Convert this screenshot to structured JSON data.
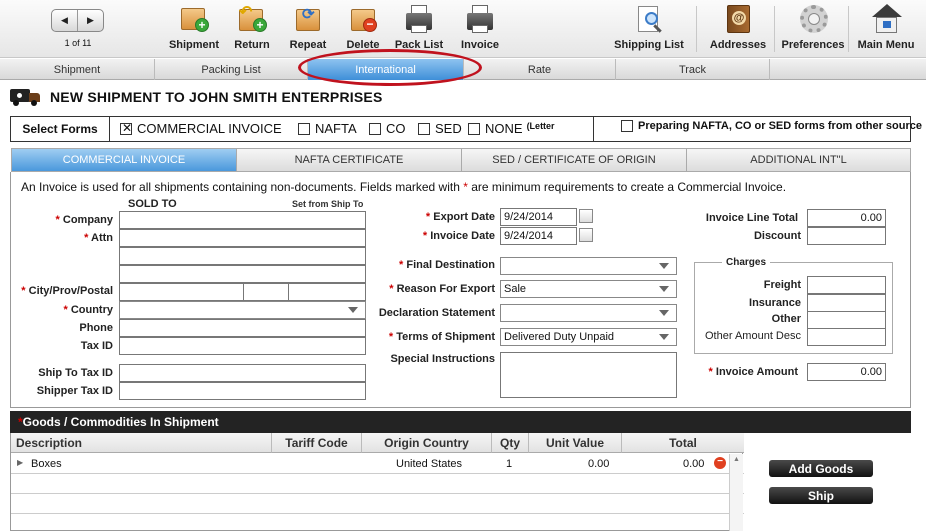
{
  "nav": {
    "prev_glyph": "◀",
    "next_glyph": "▶",
    "pager": "1 of 11"
  },
  "toolbar": {
    "shipment": "Shipment",
    "return": "Return",
    "repeat": "Repeat",
    "delete": "Delete",
    "packing_list": "Pack List",
    "invoice": "Invoice",
    "shipping_list": "Shipping List",
    "addresses": "Addresses",
    "preferences": "Preferences",
    "main_menu": "Main Menu"
  },
  "tabs": {
    "shipment": "Shipment",
    "packing_list": "Packing List",
    "international": "International",
    "rate": "Rate",
    "track": "Track"
  },
  "title": "NEW SHIPMENT TO JOHN SMITH ENTERPRISES",
  "forms": {
    "select_label": "Select Forms",
    "commercial_invoice": "COMMERCIAL INVOICE",
    "nafta": "NAFTA",
    "co": "CO",
    "sed": "SED",
    "none": "NONE",
    "none_note": "(Letter",
    "preparing": "Preparing NAFTA, CO or SED forms from other source",
    "checked_mark": "✕"
  },
  "subtabs": {
    "commercial_invoice": "COMMERCIAL INVOICE",
    "nafta_certificate": "NAFTA CERTIFICATE",
    "sed_certificate": "SED / CERTIFICATE OF ORIGIN",
    "additional": "ADDITIONAL INT\"L"
  },
  "intro": {
    "text": "An Invoice is used for all shipments containing non-documents. Fields marked with",
    "req_mark": "*",
    "text2": "are minimum requirements to create a Commercial Invoice."
  },
  "sold_to": {
    "heading": "SOLD TO",
    "set_from": "Set from Ship To",
    "req": "*",
    "company": "Company",
    "attn": "Attn",
    "city": "City/Prov/Postal",
    "country": "Country",
    "phone": "Phone",
    "tax_id": "Tax ID",
    "ship_to_tax_id": "Ship To Tax ID",
    "shipper_tax_id": "Shipper Tax ID"
  },
  "middle": {
    "export_date_label": "Export Date",
    "export_date": "9/24/2014",
    "invoice_date_label": "Invoice Date",
    "invoice_date": "9/24/2014",
    "final_destination": "Final Destination",
    "reason_label": "Reason For Export",
    "reason_value": "Sale",
    "declaration": "Declaration Statement",
    "terms_label": "Terms of Shipment",
    "terms_value": "Delivered Duty Unpaid",
    "special_instructions": "Special Instructions"
  },
  "right": {
    "line_total_label": "Invoice Line Total",
    "line_total": "0.00",
    "discount": "Discount",
    "charges": "Charges",
    "freight": "Freight",
    "insurance": "Insurance",
    "other": "Other",
    "other_desc": "Other Amount Desc",
    "invoice_amount_label": "Invoice Amount",
    "invoice_amount": "0.00"
  },
  "goods": {
    "heading": "Goods / Commodities In Shipment",
    "columns": {
      "description": "Description",
      "tariff": "Tariff Code",
      "origin": "Origin Country",
      "qty": "Qty",
      "unit_value": "Unit Value",
      "total": "Total"
    },
    "rows": [
      {
        "expand": "▶",
        "description": "Boxes",
        "origin": "United States",
        "qty": "1",
        "unit_value": "0.00",
        "total": "0.00"
      }
    ]
  },
  "buttons": {
    "add_goods": "Add Goods",
    "ship": "Ship"
  },
  "colors": {
    "active_tab": "#3f8fd8",
    "highlight_circle": "#c0121e",
    "required": "#cc0000",
    "goods_header": "#232323"
  }
}
